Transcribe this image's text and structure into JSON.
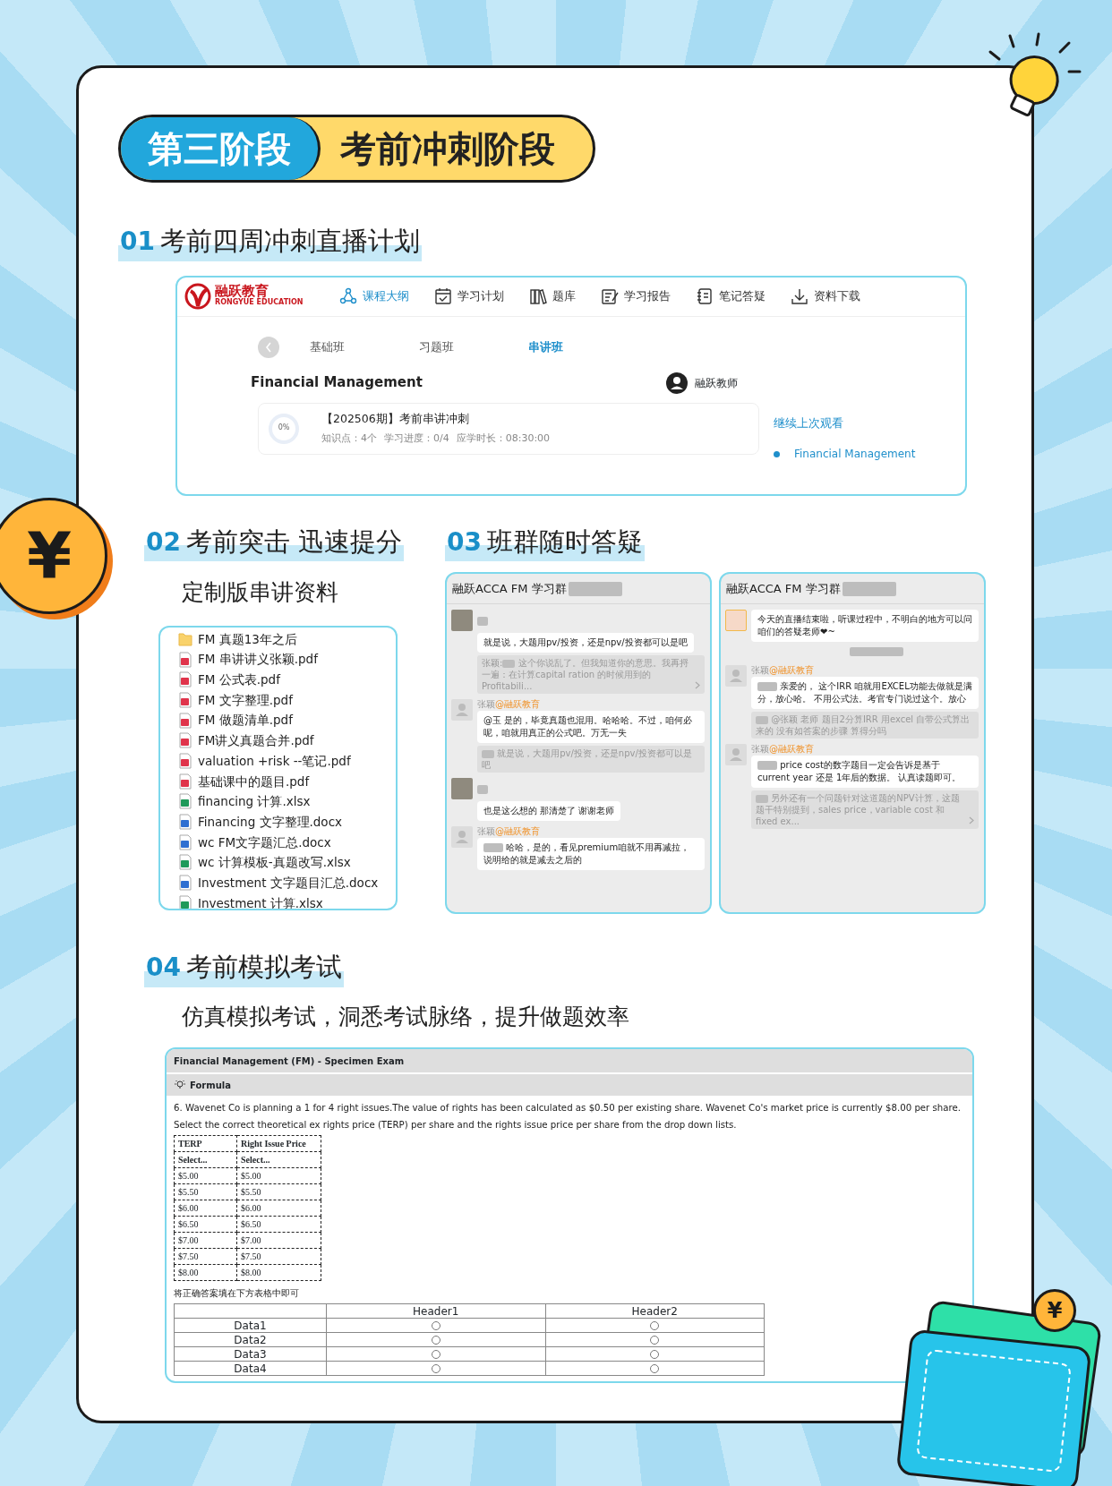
{
  "stage": {
    "label": "第三阶段",
    "title": "考前冲刺阶段"
  },
  "section_1": {
    "index": "01",
    "title": "考前四周冲刺直播计划",
    "app": {
      "logo_name": "融跃教育",
      "logo_sub": "RONGYUE EDUCATION",
      "nav": [
        {
          "label": "课程大纲",
          "selected": true
        },
        {
          "label": "学习计划",
          "selected": false
        },
        {
          "label": "题库",
          "selected": false
        },
        {
          "label": "学习报告",
          "selected": false
        },
        {
          "label": "笔记答疑",
          "selected": false
        },
        {
          "label": "资料下载",
          "selected": false
        }
      ],
      "tabs": [
        {
          "label": "基础班",
          "selected": false
        },
        {
          "label": "习题班",
          "selected": false
        },
        {
          "label": "串讲班",
          "selected": true
        }
      ],
      "course_title": "Financial Management",
      "teacher": "融跃教师",
      "course": {
        "title": "【202506期】考前串讲冲刺",
        "progress_label": "0%",
        "level": 0,
        "meta": [
          "知识点：4个",
          "学习进度：0/4",
          "应学时长：08:30:00"
        ]
      },
      "resume_link": "继续上次观看",
      "recent": [
        {
          "label": "Financial Management"
        }
      ]
    }
  },
  "section_2": {
    "index": "02",
    "title": "考前突击 迅速提分",
    "subtitle": "定制版串讲资料",
    "files": [
      {
        "name": "FM 真题13年之后",
        "kind": "folder"
      },
      {
        "name": "FM 串讲讲义张颖.pdf",
        "kind": "pdf"
      },
      {
        "name": "FM 公式表.pdf",
        "kind": "pdf"
      },
      {
        "name": "FM 文字整理.pdf",
        "kind": "pdf"
      },
      {
        "name": "FM 做题清单.pdf",
        "kind": "pdf"
      },
      {
        "name": "FM讲义真题合并.pdf",
        "kind": "pdf"
      },
      {
        "name": "valuation +risk --笔记.pdf",
        "kind": "pdf"
      },
      {
        "name": "基础课中的题目.pdf",
        "kind": "pdf"
      },
      {
        "name": "financing 计算.xlsx",
        "kind": "xlsx"
      },
      {
        "name": "Financing 文字整理.docx",
        "kind": "docx"
      },
      {
        "name": "wc FM文字题汇总.docx",
        "kind": "docx"
      },
      {
        "name": "wc 计算模板-真题改写.xlsx",
        "kind": "xlsx"
      },
      {
        "name": "Investment  文字题目汇总.docx",
        "kind": "docx"
      },
      {
        "name": "Investment 计算.xlsx",
        "kind": "xlsx"
      }
    ]
  },
  "section_3": {
    "index": "03",
    "title": "班群随时答疑",
    "chats": [
      {
        "title": "融跃ACCA FM 学习群",
        "title_redacted": true,
        "messages": [
          {
            "kind": "message",
            "avatar": {
              "kind": "photo"
            },
            "sender_redacted": true,
            "prefix_redacted": false,
            "text": "就是说，大题用pv/投资，还是npv/投资都可以是吧",
            "quote": {
              "lead": "张颖:",
              "redacted": true,
              "text": "这个你说乱了。但我知道你的意思。我再捋一遍：在计算capital ration 的时候用到的Profitabili...",
              "truncated": true
            }
          },
          {
            "kind": "message",
            "avatar": {
              "kind": "generic"
            },
            "sender": {
              "name": "张颖",
              "tag": "@融跃教育"
            },
            "prefix_redacted": false,
            "text": "@玉 是的，毕竟真题也混用。哈哈哈。不过，咱何必呢，咱就用真正的公式吧。万无一失",
            "quote": {
              "redacted": true,
              "text": "就是说，大题用pv/投资，还是npv/投资都可以是吧",
              "truncated": false
            }
          },
          {
            "kind": "message",
            "avatar": {
              "kind": "photo"
            },
            "sender_redacted": true,
            "prefix_redacted": false,
            "text": "也是这么想的 那清楚了 谢谢老师"
          },
          {
            "kind": "message",
            "avatar": {
              "kind": "generic"
            },
            "sender": {
              "name": "张颖",
              "tag": "@融跃教育"
            },
            "prefix_redacted": true,
            "text": "哈哈，是的，看见premium咱就不用再减拉，说明给的就是减去之后的"
          }
        ]
      },
      {
        "title": "融跃ACCA FM 学习群",
        "title_redacted": true,
        "messages": [
          {
            "kind": "message",
            "avatar": {
              "kind": "sticker"
            },
            "prefix_redacted": false,
            "text": "今天的直播结束啦，听课过程中，不明白的地方可以问咱们的答疑老师❤~"
          },
          {
            "kind": "timestamp"
          },
          {
            "kind": "message",
            "avatar": {
              "kind": "generic"
            },
            "sender": {
              "name": "张颖",
              "tag": "@融跃教育"
            },
            "prefix_redacted": true,
            "text": "亲爱的， 这个IRR 咱就用EXCEL功能去做就是满分，放心哈。 不用公式法。考官专门说过这个。放心",
            "quote": {
              "redacted": true,
              "text": "@张颖 老师 题目2分算IRR 用excel 自带公式算出来的 没有如答案的步骤 算得分吗",
              "truncated": false
            }
          },
          {
            "kind": "message",
            "avatar": {
              "kind": "generic"
            },
            "sender": {
              "name": "张颖",
              "tag": "@融跃教育"
            },
            "prefix_redacted": true,
            "text": "price cost的数字题目一定会告诉是基于current year 还是 1年后的数据。 认真读题即可。",
            "quote": {
              "redacted": true,
              "text": "另外还有一个问题针对这道题的NPV计算，这题题干特别提到，sales price，variable cost 和 fixed ex...",
              "truncated": true
            }
          }
        ]
      }
    ]
  },
  "section_4": {
    "index": "04",
    "title": "考前模拟考试",
    "subtitle": "仿真模拟考试，洞悉考试脉络，提升做题效率",
    "exam": {
      "title": "Financial Management (FM) - Specimen Exam",
      "tool": "Formula",
      "question": [
        "6. Wavenet Co is planning a 1 for 4 right issues.The value of rights has been calculated as $0.50 per existing share. Wavenet Co's market price is currently $8.00 per share.",
        "Select the correct theoretical ex rights price (TERP) per share and the rights issue price per share from the drop down lists."
      ],
      "options_table": {
        "columns": [
          "TERP",
          "Right Issue Price"
        ],
        "rows": [
          {
            "kind": "prompt",
            "cells": [
              "Select...",
              "Select..."
            ]
          },
          {
            "kind": "option",
            "cells": [
              "$5.00",
              "$5.00"
            ]
          },
          {
            "kind": "option",
            "cells": [
              "$5.50",
              "$5.50"
            ]
          },
          {
            "kind": "option",
            "cells": [
              "$6.00",
              "$6.00"
            ]
          },
          {
            "kind": "option",
            "cells": [
              "$6.50",
              "$6.50"
            ]
          },
          {
            "kind": "option",
            "cells": [
              "$7.00",
              "$7.00"
            ]
          },
          {
            "kind": "option",
            "cells": [
              "$7.50",
              "$7.50"
            ]
          },
          {
            "kind": "option",
            "cells": [
              "$8.00",
              "$8.00"
            ]
          }
        ]
      },
      "note": "将正确答案填在下方表格中即可",
      "matrix": {
        "columns": [
          "Header1",
          "Header2"
        ],
        "rows": [
          {
            "label": "Data1",
            "choices": [
              {
                "selected": false
              },
              {
                "selected": false
              }
            ]
          },
          {
            "label": "Data2",
            "choices": [
              {
                "selected": false
              },
              {
                "selected": false
              }
            ]
          },
          {
            "label": "Data3",
            "choices": [
              {
                "selected": false
              },
              {
                "selected": false
              }
            ]
          },
          {
            "label": "Data4",
            "choices": [
              {
                "selected": false
              },
              {
                "selected": false
              }
            ]
          }
        ]
      }
    }
  },
  "coins": [
    {
      "symbol": "¥"
    },
    {
      "symbol": "¥"
    }
  ]
}
